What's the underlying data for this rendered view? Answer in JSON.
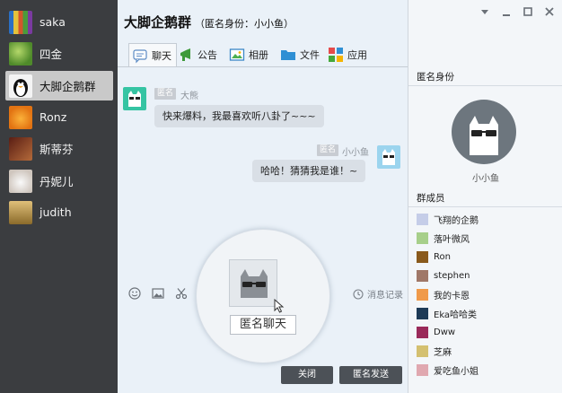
{
  "sidebar": {
    "contacts": [
      {
        "name": "saka",
        "avatar": "pencils-avatar",
        "color": "#d3562c"
      },
      {
        "name": "四金",
        "avatar": "leaves-avatar",
        "color": "#6aa33a"
      },
      {
        "name": "大脚企鹅群",
        "avatar": "penguin-avatar",
        "color": "#f2f2f2",
        "active": true
      },
      {
        "name": "Ronz",
        "avatar": "orange-avatar",
        "color": "#f08a1c"
      },
      {
        "name": "斯蒂芬",
        "avatar": "portrait-avatar",
        "color": "#8a3a2a"
      },
      {
        "name": "丹妮儿",
        "avatar": "cat-avatar",
        "color": "#e8e4e0"
      },
      {
        "name": "judith",
        "avatar": "shelf-avatar",
        "color": "#b8934a"
      }
    ]
  },
  "header": {
    "title": "大脚企鹅群",
    "subtitle": "（匿名身份：小小鱼）"
  },
  "tabs": [
    {
      "label": "聊天",
      "icon": "chat-bubble-icon",
      "active": true
    },
    {
      "label": "公告",
      "icon": "megaphone-icon"
    },
    {
      "label": "相册",
      "icon": "photo-icon"
    },
    {
      "label": "文件",
      "icon": "folder-icon"
    },
    {
      "label": "应用",
      "icon": "apps-grid-icon"
    }
  ],
  "messages": [
    {
      "side": "left",
      "tag": "匿名",
      "nick": "大熊",
      "text": "快来爆料，我最喜欢听八卦了~~~"
    },
    {
      "side": "right",
      "tag": "匿名",
      "nick": "小小鱼",
      "text": "哈哈！猜猜我是谁！~"
    }
  ],
  "toolbar": {
    "tools": [
      "smiley-icon",
      "image-icon",
      "scissors-icon"
    ],
    "history_label": "消息记录"
  },
  "magnifier": {
    "label": "匿名聊天"
  },
  "buttons": {
    "close_label": "关闭",
    "send_label": "匿名发送"
  },
  "right_panel": {
    "identity_title": "匿名身份",
    "identity_name": "小小鱼",
    "members_title": "群成员",
    "members": [
      {
        "name": "飞翔的企鹅",
        "color": "#c5cde8"
      },
      {
        "name": "落叶微风",
        "color": "#a7cf8a"
      },
      {
        "name": "Ron",
        "color": "#8a5a1c"
      },
      {
        "name": "stephen",
        "color": "#a07868"
      },
      {
        "name": "我的卡恩",
        "color": "#f09a4a"
      },
      {
        "name": "Eka哈哈类",
        "color": "#1e3a56"
      },
      {
        "name": "Dww",
        "color": "#9a2a5a"
      },
      {
        "name": "芝麻",
        "color": "#d4c070"
      },
      {
        "name": "爱吃鱼小姐",
        "color": "#e0a8b0"
      }
    ]
  },
  "window_controls": [
    "dropdown-icon",
    "minimize-icon",
    "maximize-icon",
    "close-icon"
  ]
}
